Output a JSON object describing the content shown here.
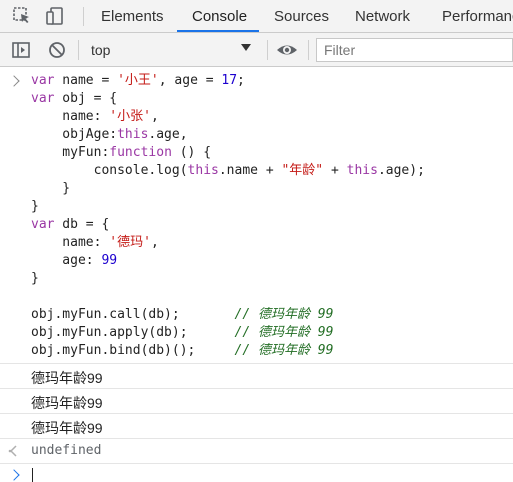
{
  "tabs": {
    "elements": "Elements",
    "console": "Console",
    "sources": "Sources",
    "network": "Network",
    "performance": "Performanc"
  },
  "toolbar": {
    "context": "top",
    "filter_placeholder": "Filter"
  },
  "colors": {
    "keyword": "#9a37a4",
    "string": "#c41a16",
    "number": "#1c00cf",
    "comment": "#236e25",
    "active_tab_underline": "#1a73e8"
  },
  "icons": [
    "inspect-icon",
    "device-toggle-icon",
    "sidebar-toggle-icon",
    "clear-console-icon",
    "chevron-down-icon",
    "eye-icon",
    "prompt-chevron-icon",
    "return-arrow-icon"
  ],
  "code": {
    "line1": [
      "var",
      " name = ",
      "'小王'",
      ", age = ",
      "17",
      ";"
    ],
    "line2": [
      "var",
      " obj = {"
    ],
    "line3": [
      "    name: ",
      "'小张'",
      ","
    ],
    "line4": [
      "    objAge:",
      "this",
      ".age,"
    ],
    "line5": [
      "    myFun:",
      "function",
      " () {"
    ],
    "line6": [
      "        console.log(",
      "this",
      ".name + ",
      "\"年龄\"",
      " + ",
      "this",
      ".age);"
    ],
    "line7": "    }",
    "line8": "}",
    "line9": [
      "var",
      " db = {"
    ],
    "line10": [
      "    name: ",
      "'德玛'",
      ","
    ],
    "line11": [
      "    age: ",
      "99"
    ],
    "line12": "}",
    "line13": [
      "obj.myFun.call(db);       ",
      "// 德玛年龄 99"
    ],
    "line14": [
      "obj.myFun.apply(db);      ",
      "// 德玛年龄 99"
    ],
    "line15": [
      "obj.myFun.bind(db)();     ",
      "// 德玛年龄 99"
    ]
  },
  "outputs": [
    "德玛年龄99",
    "德玛年龄99",
    "德玛年龄99"
  ],
  "return_value": "undefined"
}
